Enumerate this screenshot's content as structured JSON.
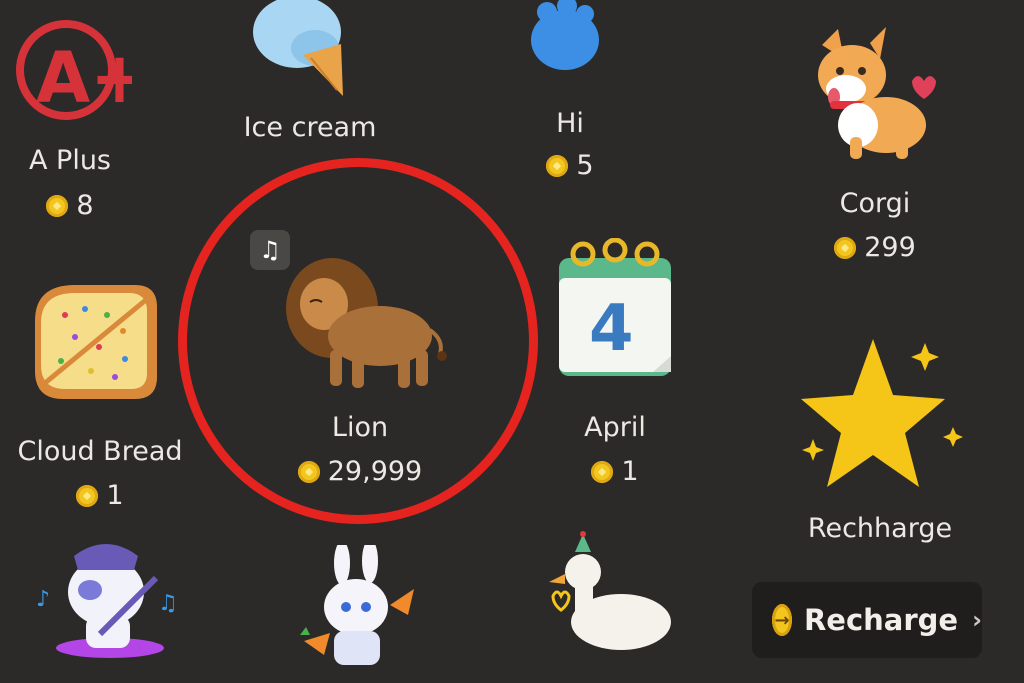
{
  "gifts": [
    {
      "id": "a-plus",
      "name": "A Plus",
      "price": "8"
    },
    {
      "id": "ice-cream",
      "name": "Ice cream"
    },
    {
      "id": "hi",
      "name": "Hi",
      "price": "5"
    },
    {
      "id": "corgi",
      "name": "Corgi",
      "price": "299"
    },
    {
      "id": "cloud-bread",
      "name": "Cloud Bread",
      "price": "1"
    },
    {
      "id": "lion",
      "name": "Lion",
      "price": "29,999"
    },
    {
      "id": "april",
      "name": "April",
      "price": "1"
    },
    {
      "id": "rechharge",
      "name": "Rechharge"
    }
  ],
  "a_plus_text": "A+",
  "calendar_number": "4",
  "recharge_button": {
    "label": "Recharge",
    "chevron": "›"
  },
  "lion_badge_icon": "♫",
  "colors": {
    "highlight_ring": "#e6241f",
    "coin": "#f3c61f",
    "background": "#2b2a28"
  }
}
